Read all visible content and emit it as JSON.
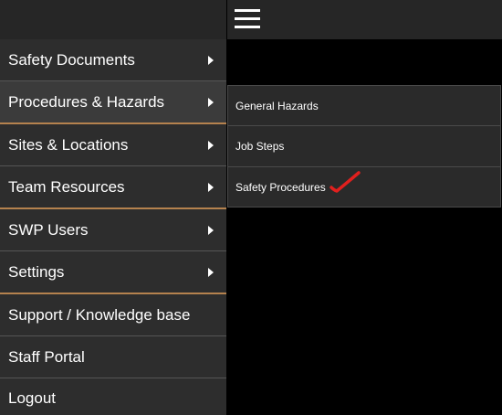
{
  "menu": {
    "items": [
      {
        "label": "Safety Documents",
        "has_submenu": true
      },
      {
        "label": "Procedures & Hazards",
        "has_submenu": true,
        "active": true
      },
      {
        "label": "Sites & Locations",
        "has_submenu": true
      },
      {
        "label": "Team Resources",
        "has_submenu": true
      },
      {
        "label": "SWP Users",
        "has_submenu": true
      },
      {
        "label": "Settings",
        "has_submenu": true
      },
      {
        "label": "Support / Knowledge base",
        "has_submenu": false
      },
      {
        "label": "Staff Portal",
        "has_submenu": false
      },
      {
        "label": "Logout",
        "has_submenu": false
      }
    ]
  },
  "submenu": {
    "items": [
      {
        "label": "General Hazards"
      },
      {
        "label": "Job Steps"
      },
      {
        "label": "Safety Procedures"
      }
    ]
  },
  "colors": {
    "background": "#000000",
    "menu_item": "#2d2d2d",
    "active_item": "#3b3b3b",
    "accent_divider": "#b5824e",
    "annotation_mark": "#e0201e"
  },
  "icons": {
    "menu_toggle": "hamburger-menu-icon",
    "submenu_indicator": "caret-right-icon",
    "annotation": "red-checkmark-annotation"
  }
}
